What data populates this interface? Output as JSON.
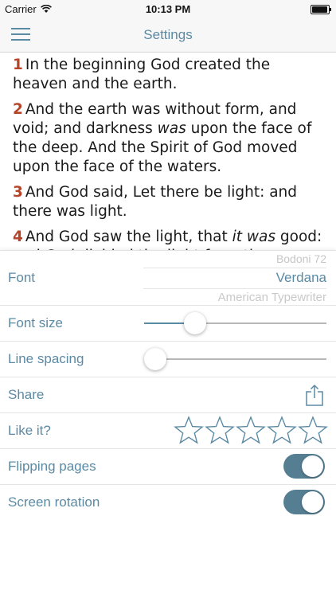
{
  "status_bar": {
    "carrier": "Carrier",
    "time": "10:13 PM"
  },
  "nav": {
    "title": "Settings"
  },
  "reader": {
    "verses": [
      {
        "num": "1",
        "text": "In the beginning God created the heaven and the earth."
      },
      {
        "num": "2",
        "html": "And the earth was without form, and void; and darkness <i>was</i> upon the face of the deep. And the Spirit of God moved upon the face of the waters."
      },
      {
        "num": "3",
        "text": "And God said, Let there be light: and there was light."
      },
      {
        "num": "4",
        "html": "And God saw the light, that <i>it was</i> good: and God divided the light from the darkness."
      }
    ]
  },
  "settings": {
    "font": {
      "label": "Font",
      "above": "Bodoni 72",
      "selected": "Verdana",
      "below": "American Typewriter"
    },
    "font_size": {
      "label": "Font size",
      "value": 0.25
    },
    "line_spacing": {
      "label": "Line spacing",
      "value": 0.0
    },
    "share": {
      "label": "Share",
      "icon": "share-icon"
    },
    "like": {
      "label": "Like it?",
      "stars_total": 5,
      "stars_filled": 0
    },
    "flipping_pages": {
      "label": "Flipping pages",
      "on": true
    },
    "screen_rotation": {
      "label": "Screen rotation",
      "on": true
    }
  },
  "colors": {
    "accent": "#5b8aa5",
    "verse_number": "#b5442a",
    "toggle_on": "#557e92"
  }
}
